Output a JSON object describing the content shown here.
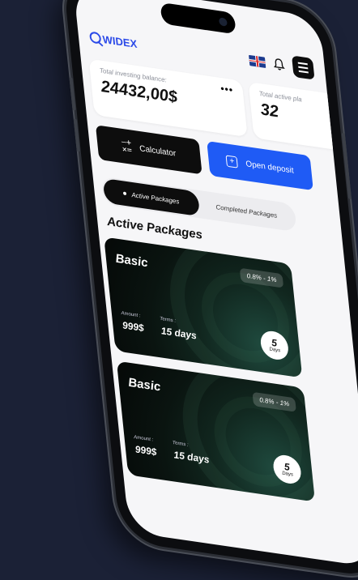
{
  "header": {
    "logo_text": "WIDEX",
    "logo_icon": "widex-logo-icon",
    "flag_icon": "uk-flag-icon",
    "bell_icon": "bell-icon",
    "menu_icon": "hamburger-menu-icon"
  },
  "balance": {
    "total_label": "Total investing balance:",
    "total_value": "24432,00$",
    "more_icon": "more-dots-icon",
    "active_label": "Total active pla",
    "active_value": "32"
  },
  "actions": {
    "calculator_label": "Calculator",
    "deposit_label": "Open deposit"
  },
  "tabs": [
    {
      "label": "Active Packages",
      "active": true
    },
    {
      "label": "Completed Packages",
      "active": false
    }
  ],
  "section_title": "Active Packages",
  "packages": [
    {
      "name": "Basic",
      "rate": "0.8% - 1%",
      "amount_label": "Amount :",
      "amount": "999$",
      "terms_label": "Terms :",
      "terms": "15 days",
      "days_num": "5",
      "days_unit": "Days"
    },
    {
      "name": "Basic",
      "rate": "0.8% - 1%",
      "amount_label": "Amount :",
      "amount": "999$",
      "terms_label": "Terms :",
      "terms": "15 days",
      "days_num": "5",
      "days_unit": "Days"
    }
  ],
  "colors": {
    "background": "#1b2136",
    "accent_blue": "#1f5bf5",
    "dark": "#0d0d0d"
  }
}
